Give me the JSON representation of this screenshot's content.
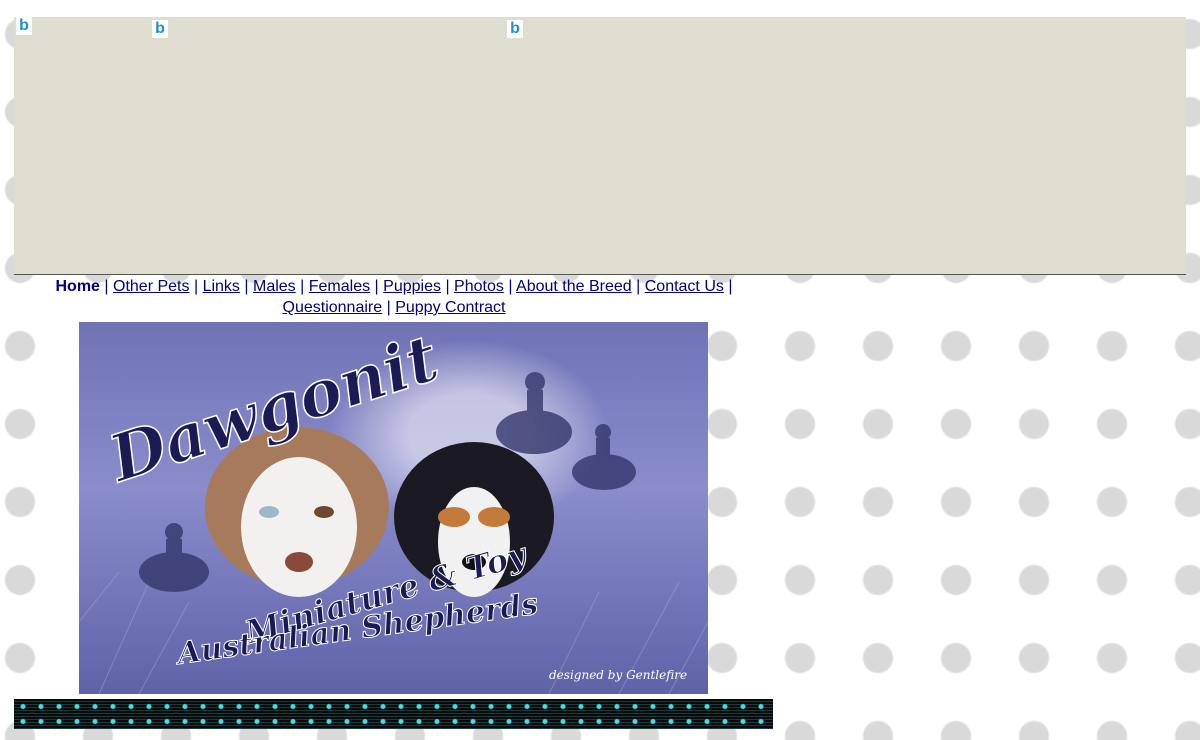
{
  "ad": {
    "badges": [
      {
        "icon": "bing-icon",
        "label": "b"
      },
      {
        "icon": "bing-icon",
        "label": "b"
      },
      {
        "icon": "bing-icon",
        "label": "b"
      }
    ]
  },
  "nav": {
    "home": "Home",
    "separator": "|",
    "links": [
      "Other Pets",
      "Links",
      "Males",
      "Females",
      "Puppies",
      "Photos",
      "About the Breed",
      "Contact Us",
      "Questionnaire",
      "Puppy Contract"
    ]
  },
  "banner": {
    "title": "Dawgonit",
    "subtitle1": "Miniature & Toy",
    "subtitle2": "Australian Shepherds",
    "credit": "designed by Gentlefire"
  },
  "colors": {
    "nav_link": "#000080",
    "ad_bg": "#dfdcd0",
    "banner_bg": "#6f73b6"
  }
}
